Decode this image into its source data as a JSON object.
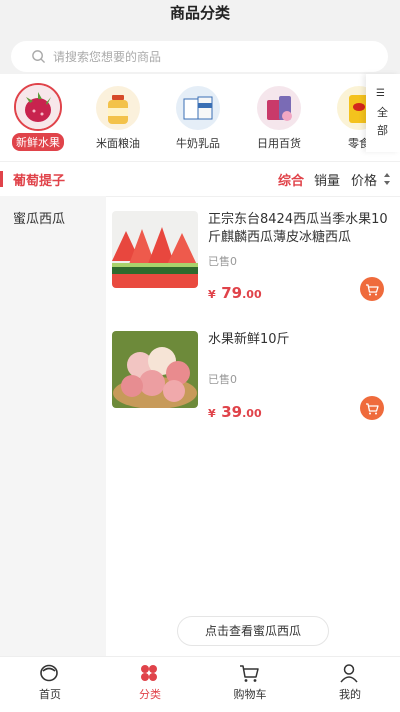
{
  "header": {
    "title": "商品分类"
  },
  "search": {
    "placeholder": "请搜索您想要的商品"
  },
  "categories": [
    {
      "label": "新鲜水果",
      "icon": "dragon-fruit-icon",
      "selected": true
    },
    {
      "label": "米面粮油",
      "icon": "oil-bottle-icon",
      "selected": false
    },
    {
      "label": "牛奶乳品",
      "icon": "milk-box-icon",
      "selected": false
    },
    {
      "label": "日用百货",
      "icon": "daily-goods-icon",
      "selected": false
    },
    {
      "label": "零食",
      "icon": "snack-icon",
      "selected": false
    }
  ],
  "all_button": {
    "glyph": "☰",
    "line1": "全",
    "line2": "部"
  },
  "subcategory": {
    "title": "葡萄提子"
  },
  "sort": {
    "comprehensive": "综合",
    "sales": "销量",
    "price": "价格"
  },
  "sidebar": {
    "items": [
      {
        "label": "蜜瓜西瓜"
      }
    ]
  },
  "products": [
    {
      "title": "正宗东台8424西瓜当季水果10斤麒麟西瓜薄皮冰糖西瓜",
      "sold": "已售0",
      "currency": "¥",
      "price_int": "79",
      "price_dec": ".00",
      "image": "watermelon-image"
    },
    {
      "title": "水果新鲜10斤",
      "sold": "已售0",
      "currency": "¥",
      "price_int": "39",
      "price_dec": ".00",
      "image": "apple-image"
    }
  ],
  "view_more": {
    "label": "点击查看蜜瓜西瓜"
  },
  "tabbar": [
    {
      "label": "首页",
      "icon": "home-icon",
      "active": false
    },
    {
      "label": "分类",
      "icon": "category-icon",
      "active": true
    },
    {
      "label": "购物车",
      "icon": "cart-icon",
      "active": false
    },
    {
      "label": "我的",
      "icon": "user-icon",
      "active": false
    }
  ],
  "colors": {
    "accent": "#e0434a",
    "cart_button": "#ef6b3c",
    "sidebar_bg": "#f5f5f5",
    "header_bg": "#f2f2f2"
  }
}
